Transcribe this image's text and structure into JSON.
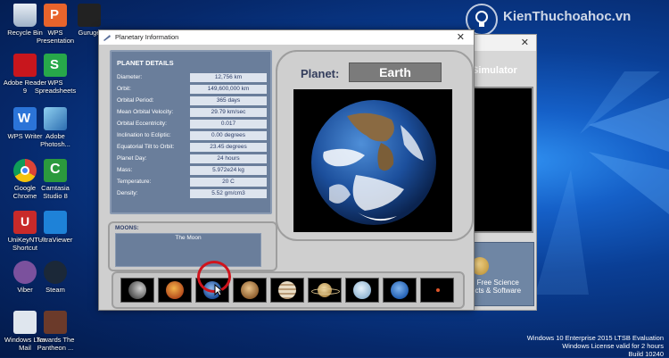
{
  "watermark": {
    "brand": "KienThuc",
    "site": ".vn",
    "full": "KienThuchoahoc.vn"
  },
  "desktop_icons": [
    {
      "label": "Recycle Bin",
      "icon": "recycle-bin-icon"
    },
    {
      "label": "WPS Presentation",
      "icon": "wps-presentation-icon"
    },
    {
      "label": "Guruge",
      "icon": "guruge-icon"
    },
    {
      "label": "Adobe Reader 9",
      "icon": "adobe-reader-icon"
    },
    {
      "label": "WPS Spreadsheets",
      "icon": "wps-spreadsheets-icon"
    },
    {
      "label": "WPS Writer",
      "icon": "wps-writer-icon"
    },
    {
      "label": "Adobe Photosh...",
      "icon": "adobe-photoshop-icon"
    },
    {
      "label": "Google Chrome",
      "icon": "google-chrome-icon"
    },
    {
      "label": "Camtasia Studio 8",
      "icon": "camtasia-icon"
    },
    {
      "label": "UniKeyNT - Shortcut",
      "icon": "unikey-icon"
    },
    {
      "label": "UltraViewer",
      "icon": "ultraviewer-icon"
    },
    {
      "label": "Viber",
      "icon": "viber-icon"
    },
    {
      "label": "Steam",
      "icon": "steam-icon"
    },
    {
      "label": "Windows Live Mail",
      "icon": "windows-live-mail-icon"
    },
    {
      "label": "Towards The Pantheon ...",
      "icon": "pantheon-game-icon"
    }
  ],
  "background_window": {
    "title_fragment": "Simulator",
    "close": "✕",
    "promo": "d Free Science ects & Software"
  },
  "window": {
    "title": "Planetary Information",
    "close": "✕"
  },
  "details": {
    "heading": "PLANET DETAILS",
    "rows": [
      {
        "label": "Diameter:",
        "value": "12,756 km"
      },
      {
        "label": "Orbit:",
        "value": "149,600,000 km"
      },
      {
        "label": "Orbital Period:",
        "value": "365 days"
      },
      {
        "label": "Mean Orbital Velocity:",
        "value": "29.79 km/sec"
      },
      {
        "label": "Orbital  Eccentricity:",
        "value": "0.017"
      },
      {
        "label": "Inclination to Ecliptic:",
        "value": "0.00 degrees"
      },
      {
        "label": "Equatorial Tilt to Orbit:",
        "value": "23.45 degrees"
      },
      {
        "label": "Planet Day:",
        "value": "24 hours"
      },
      {
        "label": "Mass:",
        "value": "5.972e24 kg"
      },
      {
        "label": "Temperature:",
        "value": "20 C"
      },
      {
        "label": "Density:",
        "value": "5.52 gm/cm3"
      }
    ]
  },
  "moons": {
    "heading": "MOONS:",
    "items": [
      "The Moon"
    ]
  },
  "viewer": {
    "label": "Planet:",
    "name": "Earth"
  },
  "planets": [
    {
      "name": "Mercury",
      "selected": false
    },
    {
      "name": "Venus",
      "selected": false
    },
    {
      "name": "Earth",
      "selected": true
    },
    {
      "name": "Mars",
      "selected": false
    },
    {
      "name": "Jupiter",
      "selected": false
    },
    {
      "name": "Saturn",
      "selected": false
    },
    {
      "name": "Uranus",
      "selected": false
    },
    {
      "name": "Neptune",
      "selected": false
    },
    {
      "name": "Pluto",
      "selected": false
    }
  ],
  "taskbar_info": {
    "line1": "Windows 10 Enterprise 2015 LTSB Evaluation",
    "line2": "Windows License valid for 2 hours",
    "line3": "Build 10240"
  },
  "colors": {
    "accent_red": "#d0141c",
    "details_panel": "#6a7e9b"
  }
}
